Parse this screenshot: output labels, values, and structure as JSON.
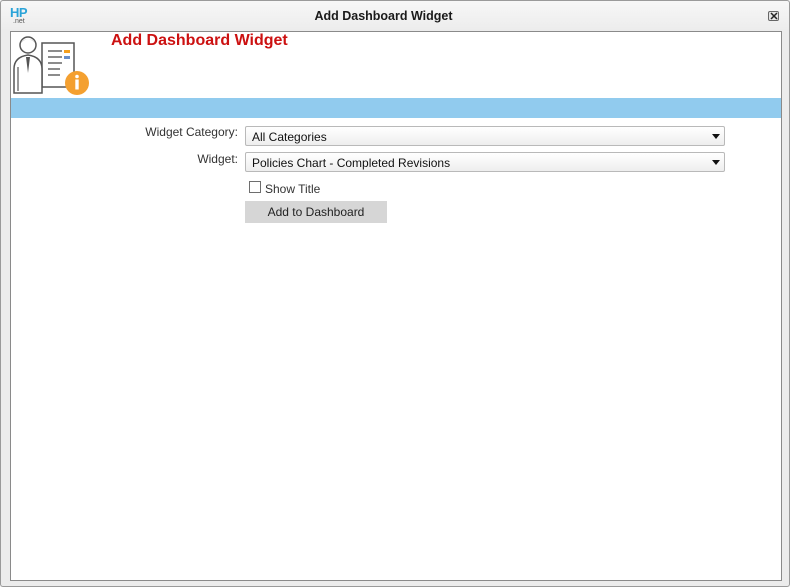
{
  "window": {
    "app_logo_text": "HP",
    "app_logo_subtext": ".net",
    "title": "Add Dashboard Widget"
  },
  "header": {
    "heading": "Add Dashboard Widget",
    "icon": "user-document-info-icon"
  },
  "form": {
    "category_label": "Widget Category:",
    "category_value": "All Categories",
    "widget_label": "Widget:",
    "widget_value": "Policies Chart - Completed Revisions",
    "show_title_label": "Show Title",
    "show_title_checked": false,
    "submit_label": "Add to Dashboard"
  },
  "colors": {
    "heading": "#cc1111",
    "band": "#91cbee",
    "button": "#d6d6d6"
  }
}
